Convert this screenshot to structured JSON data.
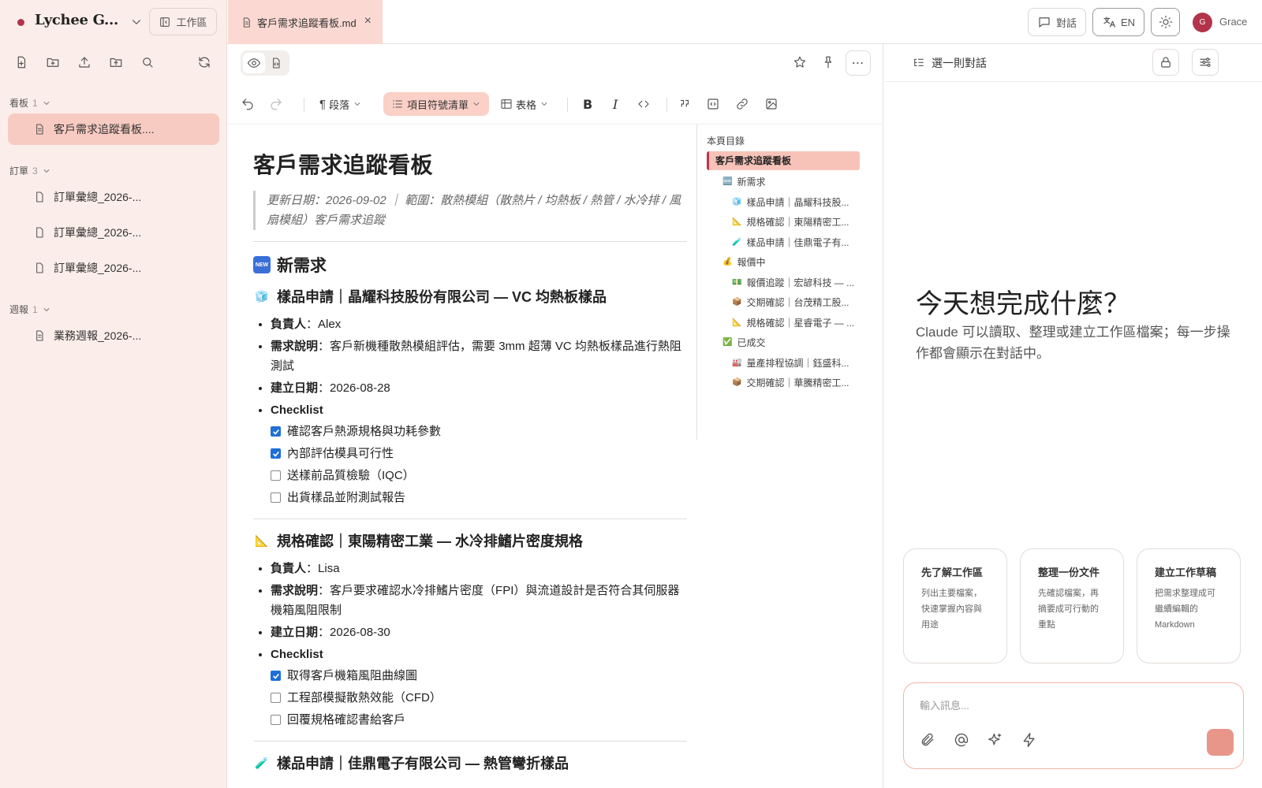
{
  "app": {
    "name": "Lychee G...",
    "workspace_label": "工作區"
  },
  "tab": {
    "title": "客戶需求追蹤看板.md",
    "close": "×"
  },
  "topbar": {
    "chat_label": "對話",
    "lang_label": "EN",
    "user_initial": "G",
    "user_name": "Grace"
  },
  "sidebar": {
    "groups": [
      {
        "label": "看板",
        "count": "1"
      },
      {
        "label": "訂單",
        "count": "3"
      },
      {
        "label": "週報",
        "count": "1"
      }
    ],
    "items": [
      {
        "label": "客戶需求追蹤看板...."
      },
      {
        "label": "訂單彙總_2026-..."
      },
      {
        "label": "訂單彙總_2026-..."
      },
      {
        "label": "訂單彙總_2026-..."
      },
      {
        "label": "業務週報_2026-..."
      }
    ]
  },
  "toolbar": {
    "paragraph": "段落",
    "bullet_list": "項目符號清單",
    "table": "表格"
  },
  "doc": {
    "title": "客戶需求追蹤看板",
    "meta": "更新日期：2026-09-02 ｜ 範圍：散熱模組（散熱片 / 均熱板 / 熱管 / 水冷排 / 風扇模組）客戶需求追蹤",
    "section_new": "新需求",
    "items": [
      {
        "icon": "🧊",
        "title": "樣品申請｜晶耀科技股份有限公司 — VC 均熱板樣品",
        "owner_label": "負責人",
        "owner": "Alex",
        "desc_label": "需求說明",
        "desc": "客戶新機種散熱模組評估，需要 3mm 超薄 VC 均熱板樣品進行熱阻測試",
        "date_label": "建立日期",
        "date": "2026-08-28",
        "checklist_label": "Checklist",
        "checklist": [
          {
            "text": "確認客戶熱源規格與功耗參數",
            "done": true
          },
          {
            "text": "內部評估模具可行性",
            "done": true
          },
          {
            "text": "送樣前品質檢驗（IQC）",
            "done": false
          },
          {
            "text": "出貨樣品並附測試報告",
            "done": false
          }
        ]
      },
      {
        "icon": "📐",
        "title": "規格確認｜東陽精密工業 — 水冷排鰭片密度規格",
        "owner_label": "負責人",
        "owner": "Lisa",
        "desc_label": "需求說明",
        "desc": "客戶要求確認水冷排鰭片密度（FPI）與流道設計是否符合其伺服器機箱風阻限制",
        "date_label": "建立日期",
        "date": "2026-08-30",
        "checklist_label": "Checklist",
        "checklist": [
          {
            "text": "取得客戶機箱風阻曲線圖",
            "done": true
          },
          {
            "text": "工程部模擬散熱效能（CFD）",
            "done": false
          },
          {
            "text": "回覆規格確認書給客戶",
            "done": false
          }
        ]
      }
    ],
    "next_heading": {
      "icon": "🧪",
      "title": "樣品申請｜佳鼎電子有限公司 — 熱管彎折樣品"
    }
  },
  "toc": {
    "title": "本頁目錄",
    "active": "客戶需求追蹤看板",
    "entries": [
      {
        "icon": "🆕",
        "text": "新需求",
        "level": 1
      },
      {
        "icon": "🧊",
        "text": "樣品申請｜晶耀科技股...",
        "level": 2
      },
      {
        "icon": "📐",
        "text": "規格確認｜東陽精密工...",
        "level": 2
      },
      {
        "icon": "🧪",
        "text": "樣品申請｜佳鼎電子有...",
        "level": 2
      },
      {
        "icon": "💰",
        "text": "報價中",
        "level": 1
      },
      {
        "icon": "💵",
        "text": "報價追蹤｜宏諺科技 — ...",
        "level": 2
      },
      {
        "icon": "📦",
        "text": "交期確認｜台茂精工股...",
        "level": 2
      },
      {
        "icon": "📐",
        "text": "規格確認｜星睿電子 — ...",
        "level": 2
      },
      {
        "icon": "✅",
        "text": "已成交",
        "level": 1
      },
      {
        "icon": "🏭",
        "text": "量產排程協調｜鈺盛科...",
        "level": 2
      },
      {
        "icon": "📦",
        "text": "交期確認｜華騰精密工...",
        "level": 2
      }
    ]
  },
  "chat": {
    "select_label": "選一則對話",
    "hero": "今天想完成什麼？",
    "sub": "Claude 可以讀取、整理或建立工作區檔案；每一步操作都會顯示在對話中。",
    "cards": [
      {
        "title": "先了解工作區",
        "desc": "列出主要檔案，快速掌握內容與用途"
      },
      {
        "title": "整理一份文件",
        "desc": "先確認檔案，再摘要成可行動的重點"
      },
      {
        "title": "建立工作草稿",
        "desc": "把需求整理成可繼續編輯的 Markdown"
      }
    ],
    "placeholder": "輸入訊息..."
  }
}
